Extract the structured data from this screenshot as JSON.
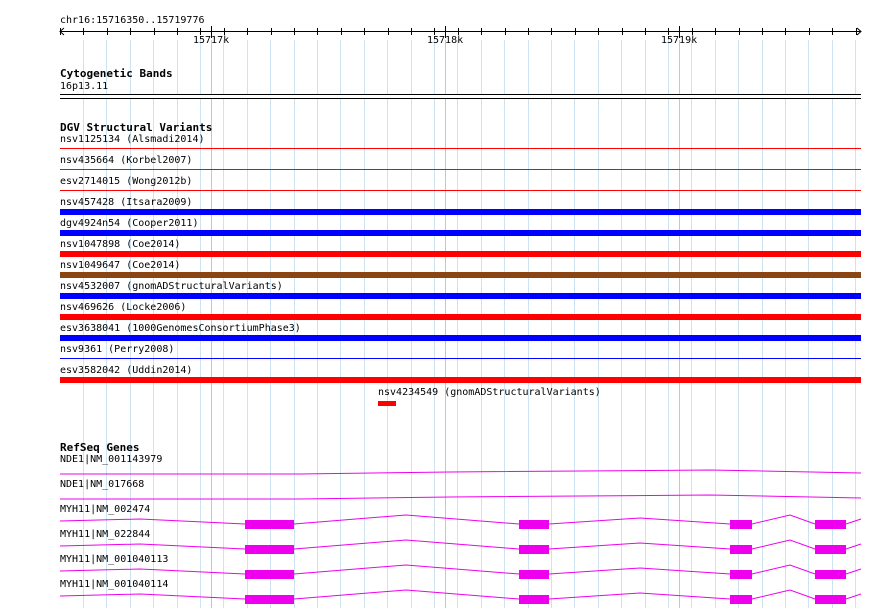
{
  "ruler": {
    "label": "chr16:15716350..15719776",
    "ticks": [
      "15717k",
      "15718k",
      "15719k"
    ]
  },
  "tracks": {
    "cytoband": {
      "title": "Cytogenetic Bands",
      "band_label": "16p13.11"
    },
    "dgv": {
      "title": "DGV Structural Variants",
      "variants": [
        {
          "label": "nsv1125134 (Alsmadi2014)",
          "color": "#ff0000",
          "kind": "thin"
        },
        {
          "label": "nsv435664 (Korbel2007)",
          "color": "#ff0000",
          "kind": "thin"
        },
        {
          "label": "esv2714015 (Wong2012b)",
          "color": "#ff0000",
          "kind": "thin"
        },
        {
          "label": "nsv457428 (Itsara2009)",
          "color": "#0000ff",
          "kind": "thick"
        },
        {
          "label": "dgv4924n54 (Cooper2011)",
          "color": "#0000ff",
          "kind": "thick"
        },
        {
          "label": "nsv1047898 (Coe2014)",
          "color": "#ff0000",
          "kind": "thick"
        },
        {
          "label": "nsv1049647 (Coe2014)",
          "color": "#8b4513",
          "kind": "thick"
        },
        {
          "label": "nsv4532007 (gnomADStructuralVariants)",
          "color": "#0000ff",
          "kind": "thick"
        },
        {
          "label": "nsv469626 (Locke2006)",
          "color": "#ff0000",
          "kind": "thick"
        },
        {
          "label": "esv3638041 (1000GenomesConsortiumPhase3)",
          "color": "#0000ff",
          "kind": "thick"
        },
        {
          "label": "nsv9361 (Perry2008)",
          "color": "#0000ff",
          "kind": "thin"
        },
        {
          "label": "esv3582042 (Uddin2014)",
          "color": "#ff0000",
          "kind": "thick"
        },
        {
          "label": "nsv4234549 (gnomADStructuralVariants)",
          "color": "#ff0000",
          "kind": "short"
        }
      ]
    },
    "refseq": {
      "title": "RefSeq Genes",
      "color": "#ee00ee",
      "genes": [
        {
          "label": "NDE1|NM_001143979",
          "exons": false
        },
        {
          "label": "NDE1|NM_017668",
          "exons": false
        },
        {
          "label": "MYH11|NM_002474",
          "exons": true
        },
        {
          "label": "MYH11|NM_022844",
          "exons": true
        },
        {
          "label": "MYH11|NM_001040113",
          "exons": true
        },
        {
          "label": "MYH11|NM_001040114",
          "exons": true
        }
      ]
    }
  }
}
